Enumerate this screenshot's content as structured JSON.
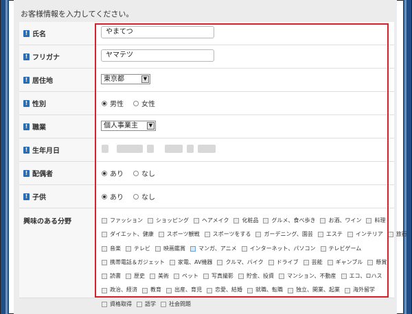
{
  "heading": "お客様情報を入力してください。",
  "fields": {
    "name": {
      "label": "氏名",
      "value": "やまてつ"
    },
    "furigana": {
      "label": "フリガナ",
      "value": "ヤマテツ"
    },
    "residence": {
      "label": "居住地",
      "value": "東京都"
    },
    "gender": {
      "label": "性別",
      "options": [
        "男性",
        "女性"
      ],
      "selected": "男性"
    },
    "occupation": {
      "label": "職業",
      "value": "個人事業主"
    },
    "birthdate": {
      "label": "生年月日"
    },
    "spouse": {
      "label": "配偶者",
      "options": [
        "あり",
        "なし"
      ],
      "selected": "あり"
    },
    "children": {
      "label": "子供",
      "options": [
        "あり",
        "なし"
      ],
      "selected": "あり"
    },
    "interests": {
      "label": "興味のある分野",
      "rows": [
        [
          "ファッション",
          "ショッピング",
          "ヘアメイク",
          "化粧品",
          "グルメ、食べ歩き",
          "お酒、ワイン",
          "料理"
        ],
        [
          "ダイエット、健康",
          "スポーツ観戦",
          "スポーツをする",
          "ガーデニング、園芸",
          "エステ",
          "インテリア",
          "旅行"
        ],
        [
          "音楽",
          "テレビ",
          "映画鑑賞",
          "マンガ、アニメ",
          "インターネット、パソコン",
          "テレビゲーム"
        ],
        [
          "携帯電話＆ガジェット",
          "家電、AV機器",
          "クルマ、バイク",
          "ドライブ",
          "芸能",
          "ギャンブル",
          "懸賞"
        ],
        [
          "読書",
          "歴史",
          "美術",
          "ペット",
          "写真撮影",
          "貯金、投資",
          "マンション、不動産",
          "エコ、ロハス"
        ],
        [
          "政治、経済",
          "教育",
          "出産、育児",
          "恋愛、結婚",
          "就職、転職",
          "独立、開業、起業",
          "海外留学"
        ],
        [
          "資格取得",
          "語学",
          "社会問題"
        ]
      ]
    }
  },
  "colors": {
    "accent": "#d8202a",
    "info_mark": "#2a6db5",
    "side_bar": "#1f4f86"
  },
  "icons": {
    "info_mark": "!",
    "select_arrow": "▼"
  }
}
